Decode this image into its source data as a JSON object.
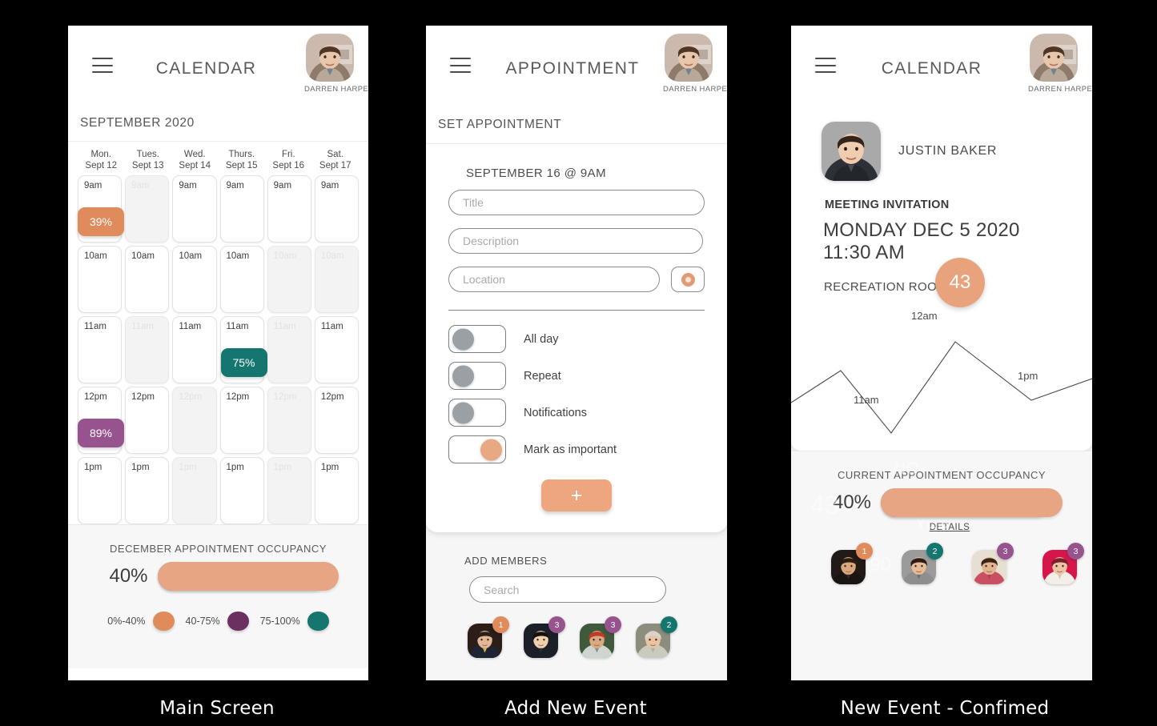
{
  "captions": {
    "screen1": "Main Screen",
    "screen2": "Add New Event",
    "screen3": "New Event - Confimed"
  },
  "colors": {
    "orange": "#e08b5c",
    "orange_light": "#eda67e",
    "purple": "#96538e",
    "purple_dark": "#6b3060",
    "teal": "#15756f",
    "bar_fill": "#e8a584",
    "bar_track": "#fdfbf7"
  },
  "user": {
    "name": "DARREN HARPER"
  },
  "screen1": {
    "title": "CALENDAR",
    "month": "SEPTEMBER 2020",
    "days": [
      {
        "dow": "Mon.",
        "date": "Sept 12"
      },
      {
        "dow": "Tues.",
        "date": "Sept 13"
      },
      {
        "dow": "Wed.",
        "date": "Sept 14"
      },
      {
        "dow": "Thurs.",
        "date": "Sept 15"
      },
      {
        "dow": "Fri.",
        "date": "Sept 16"
      },
      {
        "dow": "Sat.",
        "date": "Sept 17"
      }
    ],
    "rows": [
      {
        "hour": "9am",
        "cells": [
          {
            "label": "9am",
            "dim": false,
            "chip": "39%",
            "chip_color": "#e08b5c"
          },
          {
            "label": "9am",
            "dim": true,
            "chip": null,
            "chip_color": null
          },
          {
            "label": "9am",
            "dim": false,
            "chip": null,
            "chip_color": null
          },
          {
            "label": "9am",
            "dim": false,
            "chip": null,
            "chip_color": null
          },
          {
            "label": "9am",
            "dim": false,
            "chip": null,
            "chip_color": null
          },
          {
            "label": "9am",
            "dim": false,
            "chip": null,
            "chip_color": null
          }
        ]
      },
      {
        "hour": "10am",
        "cells": [
          {
            "label": "10am",
            "dim": false,
            "chip": null,
            "chip_color": null
          },
          {
            "label": "10am",
            "dim": false,
            "chip": null,
            "chip_color": null
          },
          {
            "label": "10am",
            "dim": false,
            "chip": null,
            "chip_color": null
          },
          {
            "label": "10am",
            "dim": false,
            "chip": null,
            "chip_color": null
          },
          {
            "label": "10am",
            "dim": true,
            "chip": null,
            "chip_color": null
          },
          {
            "label": "10am",
            "dim": true,
            "chip": null,
            "chip_color": null
          }
        ]
      },
      {
        "hour": "11am",
        "cells": [
          {
            "label": "11am",
            "dim": false,
            "chip": null,
            "chip_color": null
          },
          {
            "label": "11am",
            "dim": true,
            "chip": null,
            "chip_color": null
          },
          {
            "label": "11am",
            "dim": false,
            "chip": null,
            "chip_color": null
          },
          {
            "label": "11am",
            "dim": false,
            "chip": "75%",
            "chip_color": "#15756f"
          },
          {
            "label": "11am",
            "dim": true,
            "chip": null,
            "chip_color": null
          },
          {
            "label": "11am",
            "dim": false,
            "chip": null,
            "chip_color": null
          }
        ]
      },
      {
        "hour": "12pm",
        "cells": [
          {
            "label": "12pm",
            "dim": false,
            "chip": "89%",
            "chip_color": "#96538e"
          },
          {
            "label": "12pm",
            "dim": false,
            "chip": null,
            "chip_color": null
          },
          {
            "label": "12pm",
            "dim": true,
            "chip": null,
            "chip_color": null
          },
          {
            "label": "12pm",
            "dim": false,
            "chip": null,
            "chip_color": null
          },
          {
            "label": "12pm",
            "dim": true,
            "chip": null,
            "chip_color": null
          },
          {
            "label": "12pm",
            "dim": false,
            "chip": null,
            "chip_color": null
          }
        ]
      },
      {
        "hour": "1pm",
        "cells": [
          {
            "label": "1pm",
            "dim": false,
            "chip": null,
            "chip_color": null
          },
          {
            "label": "1pm",
            "dim": false,
            "chip": null,
            "chip_color": null
          },
          {
            "label": "1pm",
            "dim": true,
            "chip": null,
            "chip_color": null
          },
          {
            "label": "1pm",
            "dim": false,
            "chip": null,
            "chip_color": null
          },
          {
            "label": "1pm",
            "dim": true,
            "chip": null,
            "chip_color": null
          },
          {
            "label": "1pm",
            "dim": false,
            "chip": null,
            "chip_color": null
          }
        ]
      }
    ],
    "occupancy": {
      "title": "DECEMBER APPOINTMENT OCCUPANCY",
      "percent_label": "40%",
      "percent_value": 40,
      "legend": [
        {
          "label": "0%-40%",
          "color": "#e08b5c"
        },
        {
          "label": "40-75%",
          "color": "#6b3060"
        },
        {
          "label": "75-100%",
          "color": "#15756f"
        }
      ]
    }
  },
  "screen2": {
    "title": "APPOINTMENT",
    "sub_header": "SET APPOINTMENT",
    "slot": "SEPTEMBER 16  @ 9AM",
    "fields": [
      {
        "name": "title",
        "placeholder": "Title",
        "value": ""
      },
      {
        "name": "description",
        "placeholder": "Description",
        "value": ""
      },
      {
        "name": "location",
        "placeholder": "Location",
        "value": ""
      }
    ],
    "toggles": [
      {
        "label": "All day",
        "on": false
      },
      {
        "label": "Repeat",
        "on": false
      },
      {
        "label": "Notifications",
        "on": false
      },
      {
        "label": "Mark as important",
        "on": true
      }
    ],
    "add_button": "+",
    "members": {
      "title": "ADD MEMBERS",
      "search_placeholder": "Search",
      "search_value": "",
      "people": [
        {
          "badge": "1",
          "badge_color": "#e08b5c"
        },
        {
          "badge": "3",
          "badge_color": "#96538e"
        },
        {
          "badge": "3",
          "badge_color": "#96538e"
        },
        {
          "badge": "2",
          "badge_color": "#15756f"
        }
      ]
    }
  },
  "screen3": {
    "title": "CALENDAR",
    "invitee_name": "JUSTIN BAKER",
    "meeting_label": "MEETING INVITATION",
    "meeting_date_line1": "MONDAY DEC 5 2020",
    "meeting_date_line2": "11:30 AM",
    "room": "RECREATION ROOM EW",
    "room_count": "43",
    "ghosts": {
      "number": "43",
      "no": "NO",
      "yes": "YES",
      "amount": "890"
    },
    "chart_data": {
      "type": "line",
      "title": "",
      "xlabel": "",
      "ylabel": "",
      "point_labels": [
        "11am",
        "12am",
        "1pm"
      ],
      "axis_ticks": [
        "30",
        "80",
        "11"
      ],
      "x": [
        0,
        62,
        125,
        205,
        300,
        376
      ],
      "y": [
        118,
        78,
        156,
        42,
        115,
        88
      ],
      "grid": false,
      "legend": "none"
    },
    "occupancy": {
      "title": "CURRENT APPOINTMENT OCCUPANCY",
      "percent_label": "40%",
      "percent_value": 40,
      "details": "DETAILS"
    },
    "people": [
      {
        "badge": "1",
        "badge_color": "#e08b5c"
      },
      {
        "badge": "2",
        "badge_color": "#15756f"
      },
      {
        "badge": "3",
        "badge_color": "#96538e"
      },
      {
        "badge": "3",
        "badge_color": "#96538e"
      }
    ]
  }
}
